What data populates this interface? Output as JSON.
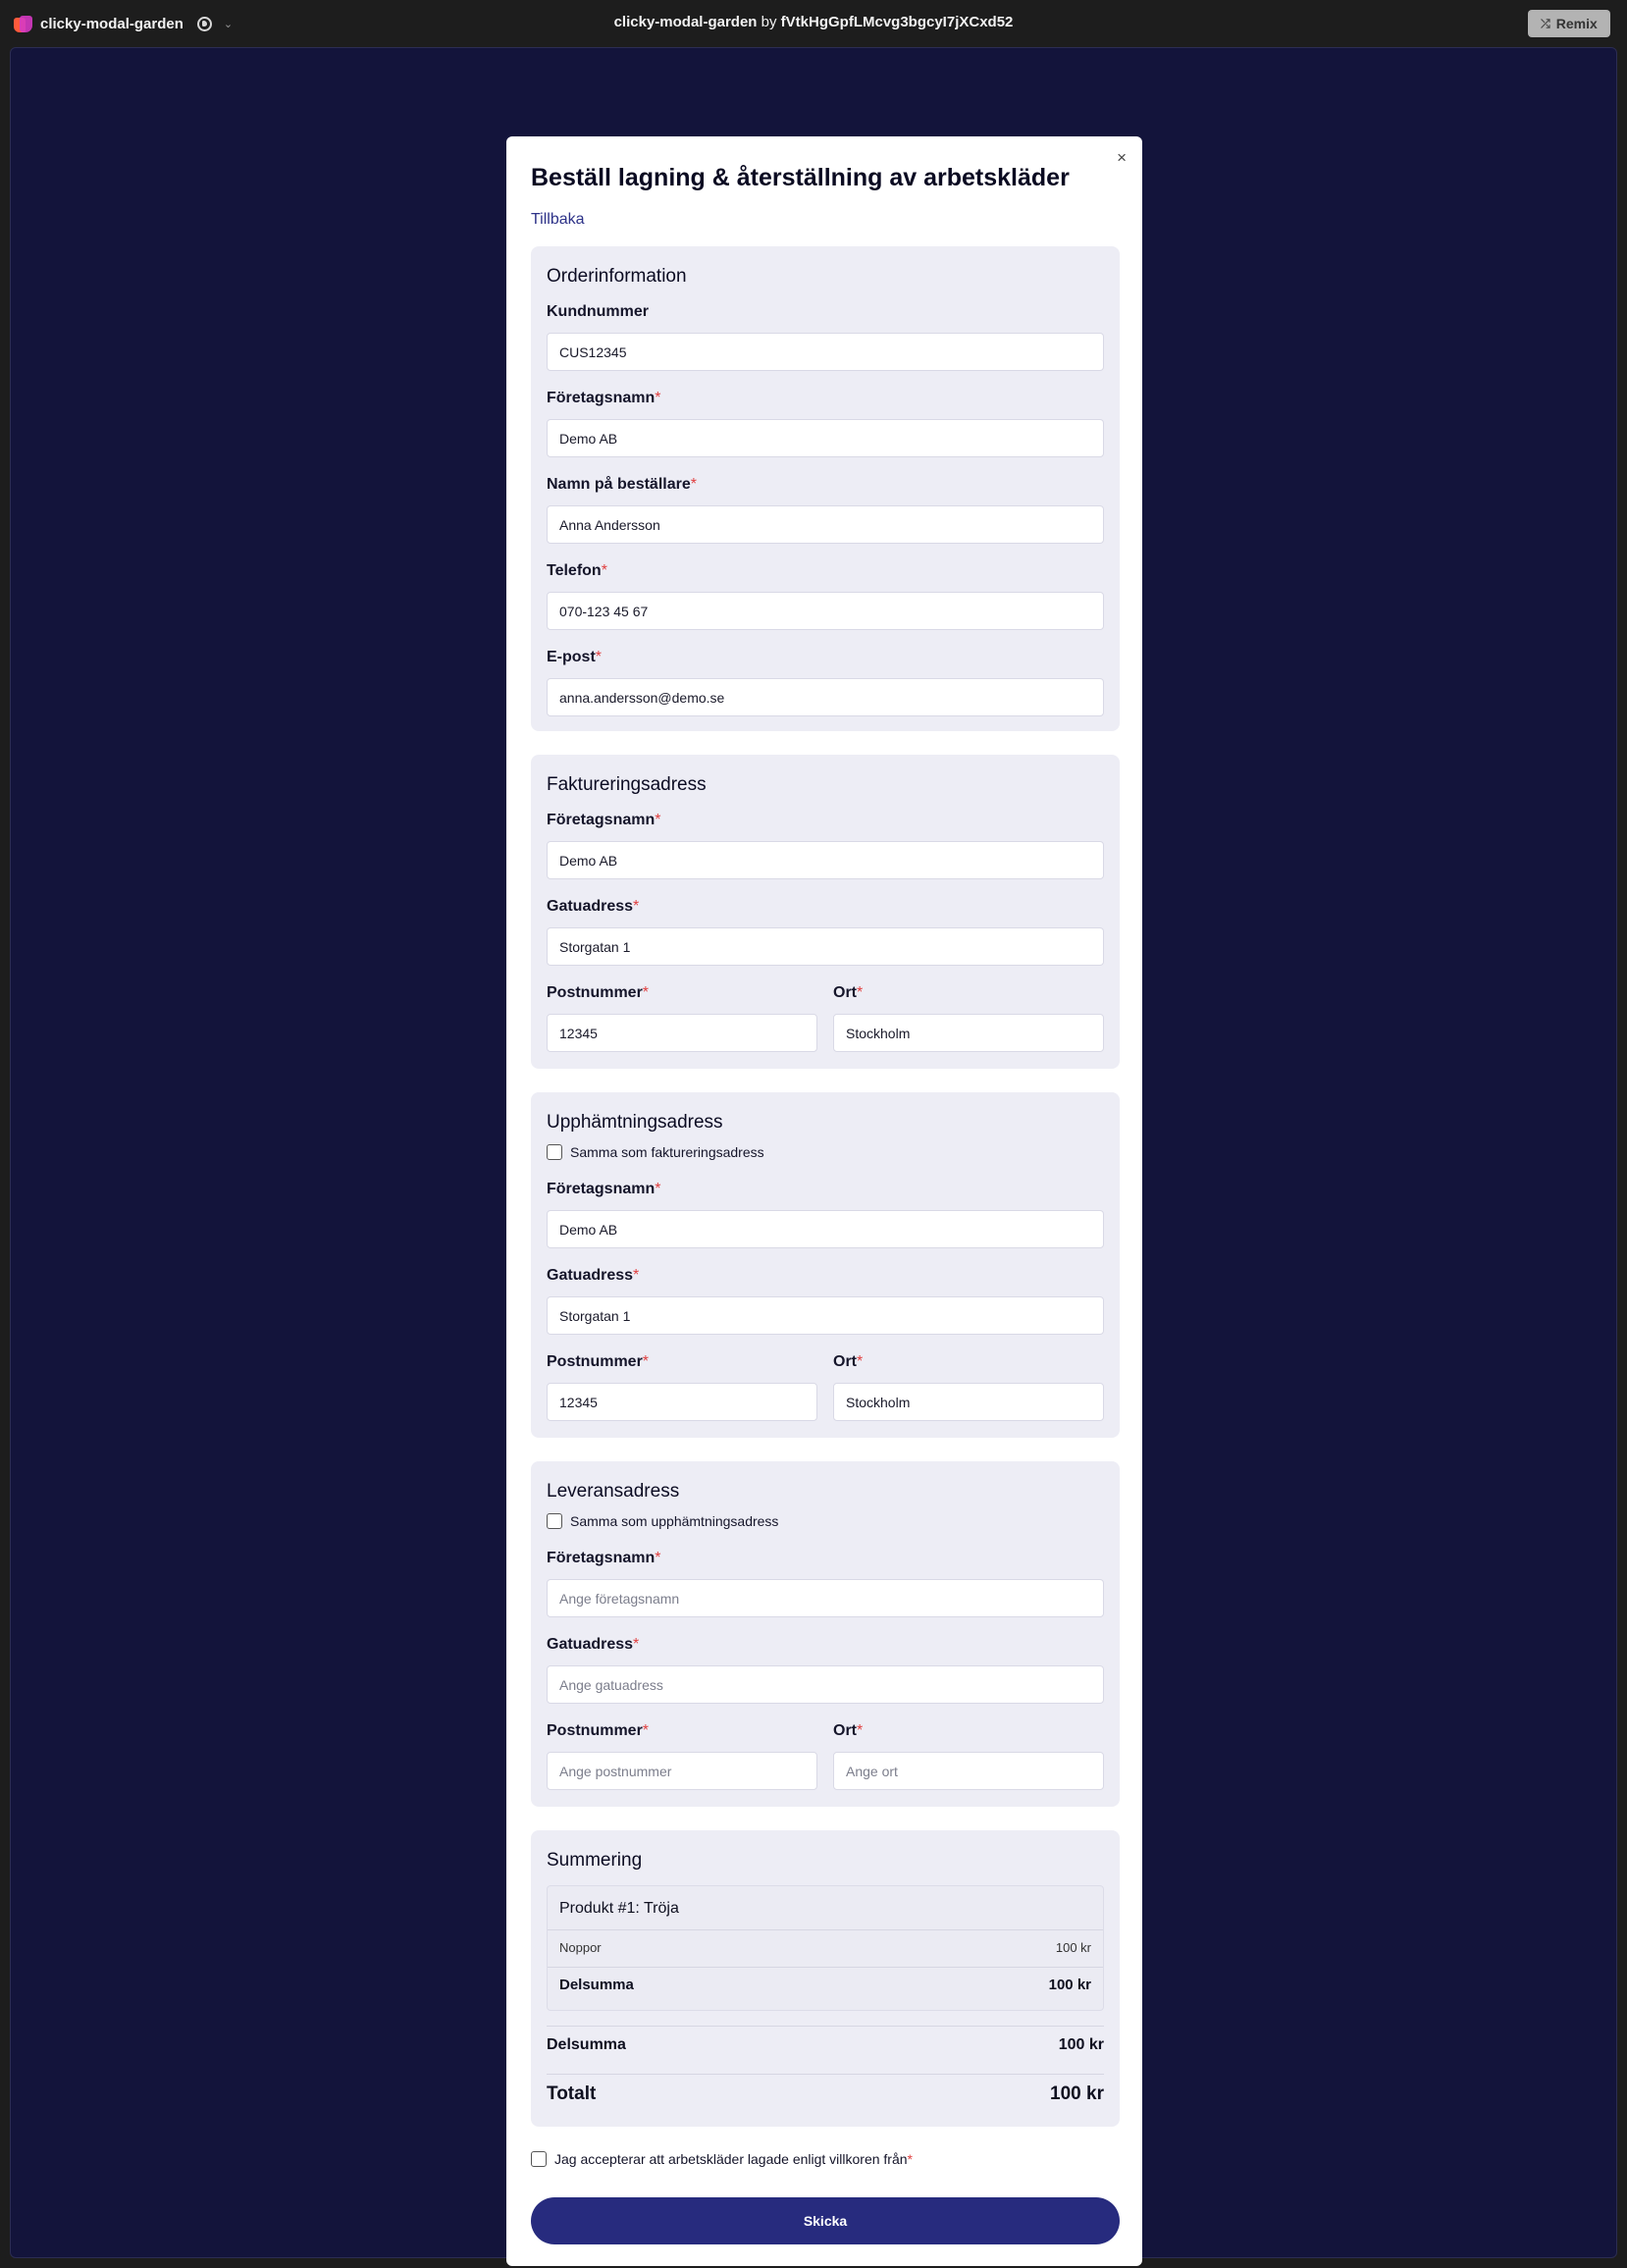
{
  "topbar": {
    "app_name": "clicky-modal-garden",
    "center_name": "clicky-modal-garden",
    "center_by": "by",
    "center_user": "fVtkHgGpfLMcvg3bgcyI7jXCxd52",
    "remix_label": "Remix"
  },
  "modal": {
    "title": "Beställ lagning & återställning av arbetskläder",
    "back_label": "Tillbaka",
    "close_symbol": "×",
    "required_mark": "*"
  },
  "order": {
    "title": "Orderinformation",
    "customer_label": "Kundnummer",
    "customer_value": "CUS12345",
    "company_label": "Företagsnamn",
    "company_value": "Demo AB",
    "orderer_label": "Namn på beställare",
    "orderer_value": "Anna Andersson",
    "phone_label": "Telefon",
    "phone_value": "070-123 45 67",
    "email_label": "E-post",
    "email_value": "anna.andersson@demo.se"
  },
  "billing": {
    "title": "Faktureringsadress",
    "company_label": "Företagsnamn",
    "company_value": "Demo AB",
    "street_label": "Gatuadress",
    "street_value": "Storgatan 1",
    "zip_label": "Postnummer",
    "zip_value": "12345",
    "city_label": "Ort",
    "city_value": "Stockholm"
  },
  "pickup": {
    "title": "Upphämtningsadress",
    "same_label": "Samma som faktureringsadress",
    "same_checked": false,
    "company_label": "Företagsnamn",
    "company_value": "Demo AB",
    "street_label": "Gatuadress",
    "street_value": "Storgatan 1",
    "zip_label": "Postnummer",
    "zip_value": "12345",
    "city_label": "Ort",
    "city_value": "Stockholm"
  },
  "delivery": {
    "title": "Leveransadress",
    "same_label": "Samma som upphämtningsadress",
    "same_checked": false,
    "company_label": "Företagsnamn",
    "company_placeholder": "Ange företagsnamn",
    "street_label": "Gatuadress",
    "street_placeholder": "Ange gatuadress",
    "zip_label": "Postnummer",
    "zip_placeholder": "Ange postnummer",
    "city_label": "Ort",
    "city_placeholder": "Ange ort"
  },
  "summary": {
    "title": "Summering",
    "product_title": "Produkt #1: Tröja",
    "line_label": "Noppor",
    "line_value": "100 kr",
    "product_subtotal_label": "Delsumma",
    "product_subtotal_value": "100 kr",
    "subtotal_label": "Delsumma",
    "subtotal_value": "100 kr",
    "total_label": "Totalt",
    "total_value": "100 kr"
  },
  "terms": {
    "label": "Jag accepterar att arbetskläder lagade enligt villkoren från",
    "checked": false
  },
  "submit_label": "Skicka",
  "colors": {
    "stage_bg": "#13143b",
    "section_bg": "#ededf5",
    "primary": "#272b7e",
    "link": "#2d3288",
    "required": "#e04040"
  }
}
